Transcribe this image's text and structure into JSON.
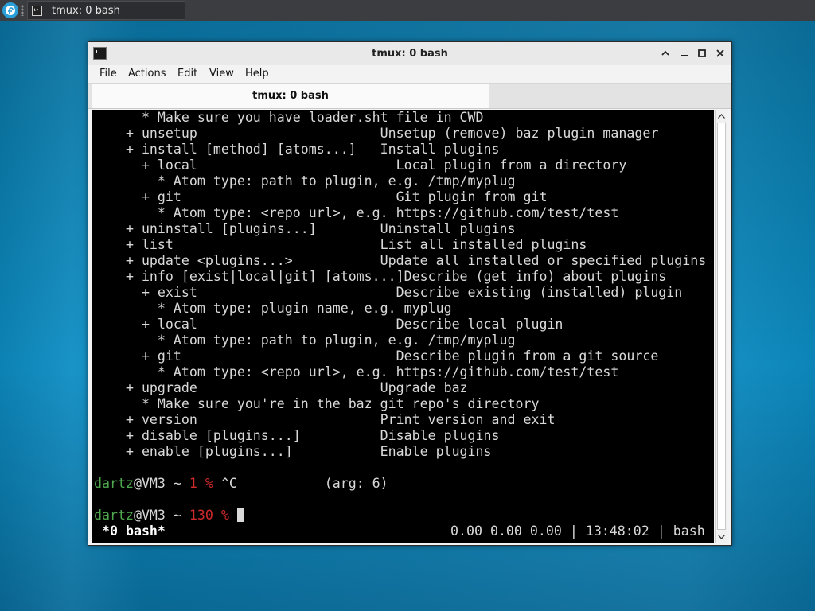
{
  "taskbar": {
    "start_icon": "fedora-logo-icon",
    "task_title": "tmux: 0 bash"
  },
  "window": {
    "title": "tmux: 0 bash",
    "controls": [
      "minimize-icon",
      "restore-icon",
      "close-icon"
    ]
  },
  "menu": {
    "file": "File",
    "actions": "Actions",
    "edit": "Edit",
    "view": "View",
    "help": "Help"
  },
  "tab": {
    "label": "tmux: 0 bash"
  },
  "terminal": {
    "lines": [
      "      * Make sure you have loader.sht file in CWD",
      "    + unsetup                       Unsetup (remove) baz plugin manager",
      "    + install [method] [atoms...]   Install plugins",
      "      + local                         Local plugin from a directory",
      "        * Atom type: path to plugin, e.g. /tmp/myplug",
      "      + git                           Git plugin from git",
      "        * Atom type: <repo url>, e.g. https://github.com/test/test",
      "    + uninstall [plugins...]        Uninstall plugins",
      "    + list                          List all installed plugins",
      "    + update <plugins...>           Update all installed or specified plugins",
      "    + info [exist|local|git] [atoms...]Describe (get info) about plugins",
      "      + exist                         Describe existing (installed) plugin",
      "        * Atom type: plugin name, e.g. myplug",
      "      + local                         Describe local plugin",
      "        * Atom type: path to plugin, e.g. /tmp/myplug",
      "      + git                           Describe plugin from a git source",
      "        * Atom type: <repo url>, e.g. https://github.com/test/test",
      "    + upgrade                       Upgrade baz",
      "      * Make sure you're in the baz git repo's directory",
      "    + version                       Print version and exit",
      "    + disable [plugins...]          Disable plugins",
      "    + enable [plugins...]           Enable plugins"
    ],
    "prompt1": {
      "user": "dartz",
      "host": "@VM3 ~ ",
      "status": "1 % ",
      "rest": "^C           (arg: 6)"
    },
    "prompt2": {
      "user": "dartz",
      "host": "@VM3 ~ ",
      "status": "130 % "
    },
    "statusbar": {
      "window": " *0 bash*",
      "right": "0.00 0.00 0.00 | 13:48:02 | bash"
    }
  },
  "colors": {
    "prompt_user": "#4ea84e",
    "prompt_status": "#d02a2a",
    "terminal_bg": "#000000",
    "terminal_fg": "#d9d9d9"
  }
}
